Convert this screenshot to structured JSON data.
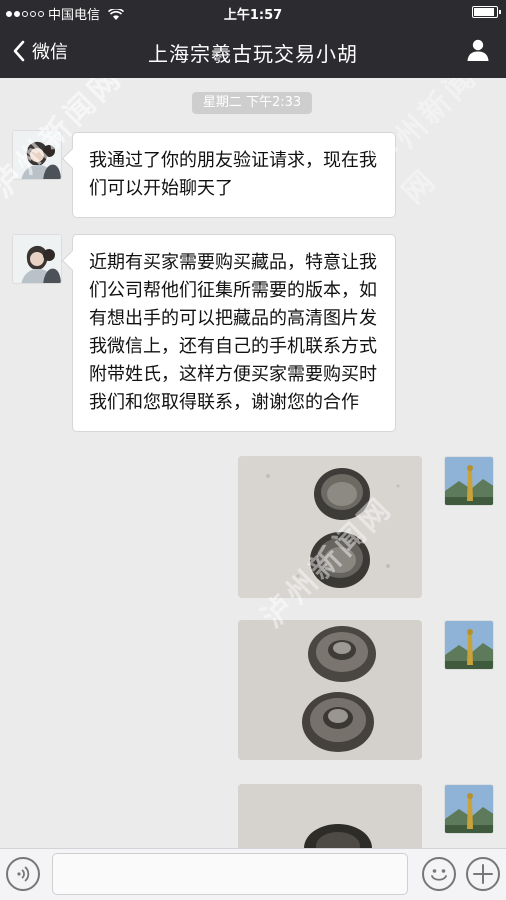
{
  "status_bar": {
    "carrier": "中国电信",
    "time": "上午1:57",
    "signal_bars": 2,
    "battery_level": 0.9
  },
  "nav": {
    "back_label": "微信",
    "title": "上海宗羲古玩交易小胡"
  },
  "chat": {
    "timestamp": "星期二 下午2:33",
    "messages": [
      {
        "sender": "contact",
        "type": "text",
        "text": "我通过了你的朋友验证请求，现在我们可以开始聊天了"
      },
      {
        "sender": "contact",
        "type": "text",
        "text": "近期有买家需要购买藏品，特意让我们公司帮他们征集所需要的版本，如有想出手的可以把藏品的高清图片发我微信上，还有自己的手机联系方式附带姓氏，这样方便买家需要购买时我们和您取得联系，谢谢您的合作"
      },
      {
        "sender": "me",
        "type": "image",
        "image_desc": "two silver cups"
      },
      {
        "sender": "me",
        "type": "image",
        "image_desc": "two engraved silver items"
      },
      {
        "sender": "me",
        "type": "image",
        "image_desc": "silver item partially visible"
      }
    ]
  },
  "watermark": {
    "text": "泸州新闻网"
  },
  "colors": {
    "bar_bg": "#2b2b30",
    "chat_bg": "#ebebeb",
    "bubble_bg": "#ffffff",
    "timestamp_bg": "#cecece"
  }
}
